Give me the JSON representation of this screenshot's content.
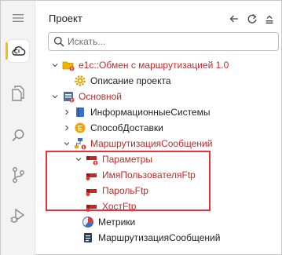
{
  "panel": {
    "title": "Проект",
    "search_placeholder": "Искать..."
  },
  "activity_icons": [
    "menu-icon",
    "cloud-icon",
    "files-icon",
    "search-icon",
    "source-control-icon",
    "run-debug-icon"
  ],
  "tree": [
    {
      "label": "e1c::Обмен с маршрутизацией 1.0",
      "color": "red",
      "icon": "project-folder-icon",
      "expanded": true
    },
    {
      "label": "Описание проекта",
      "color": "default",
      "icon": "gear-icon"
    },
    {
      "label": "Основной",
      "color": "red",
      "icon": "module-icon",
      "expanded": true
    },
    {
      "label": "ИнформационныеСистемы",
      "color": "default",
      "icon": "catalog-icon",
      "expanded": false
    },
    {
      "label": "СпособДоставки",
      "color": "default",
      "icon": "enum-icon",
      "expanded": false
    },
    {
      "label": "МаршрутизацияСообщений",
      "color": "red",
      "icon": "routing-icon",
      "expanded": true
    },
    {
      "label": "Параметры",
      "color": "red",
      "icon": "parameters-icon",
      "expanded": true
    },
    {
      "label": "ИмяПользователяFtp",
      "color": "red",
      "icon": "parameter-icon"
    },
    {
      "label": "ПарольFtp",
      "color": "red",
      "icon": "parameter-icon"
    },
    {
      "label": "ХостFtp",
      "color": "red",
      "icon": "parameter-icon"
    },
    {
      "label": "Метрики",
      "color": "default",
      "icon": "metrics-icon"
    },
    {
      "label": "МаршрутизацияСообщений",
      "color": "default",
      "icon": "module-file-icon"
    }
  ],
  "colors": {
    "accent_yellow": "#f2c200",
    "error_red": "#c62828",
    "highlight_red": "#e5323a"
  }
}
